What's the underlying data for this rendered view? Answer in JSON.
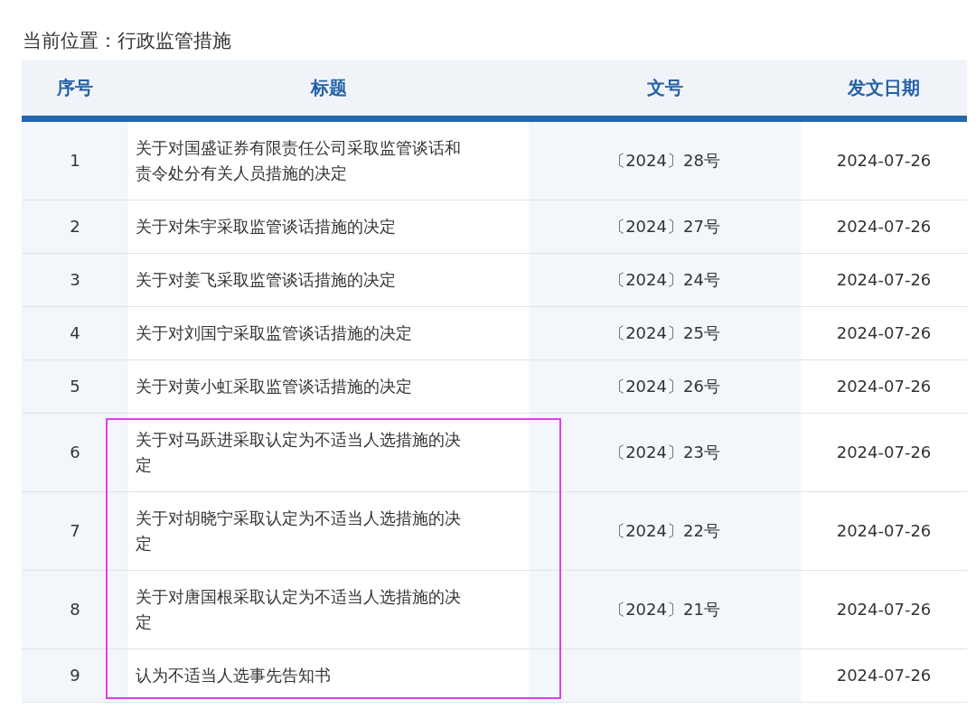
{
  "breadcrumb": {
    "label": "当前位置：",
    "current": "行政监管措施"
  },
  "table": {
    "columns": [
      "序号",
      "标题",
      "文号",
      "发文日期"
    ],
    "rows": [
      {
        "no": "1",
        "title": "关于对国盛证券有限责任公司采取监管谈话和责令处分有关人员措施的决定",
        "doc_no": "〔2024〕28号",
        "date": "2024-07-26",
        "highlighted": false
      },
      {
        "no": "2",
        "title": "关于对朱宇采取监管谈话措施的决定",
        "doc_no": "〔2024〕27号",
        "date": "2024-07-26",
        "highlighted": false
      },
      {
        "no": "3",
        "title": "关于对姜飞采取监管谈话措施的决定",
        "doc_no": "〔2024〕24号",
        "date": "2024-07-26",
        "highlighted": false
      },
      {
        "no": "4",
        "title": "关于对刘国宁采取监管谈话措施的决定",
        "doc_no": "〔2024〕25号",
        "date": "2024-07-26",
        "highlighted": false
      },
      {
        "no": "5",
        "title": "关于对黄小虹采取监管谈话措施的决定",
        "doc_no": "〔2024〕26号",
        "date": "2024-07-26",
        "highlighted": false
      },
      {
        "no": "6",
        "title": "关于对马跃进采取认定为不适当人选措施的决定",
        "doc_no": "〔2024〕23号",
        "date": "2024-07-26",
        "highlighted": true
      },
      {
        "no": "7",
        "title": "关于对胡晓宁采取认定为不适当人选措施的决定",
        "doc_no": "〔2024〕22号",
        "date": "2024-07-26",
        "highlighted": true
      },
      {
        "no": "8",
        "title": "关于对唐国根采取认定为不适当人选措施的决定",
        "doc_no": "〔2024〕21号",
        "date": "2024-07-26",
        "highlighted": true
      },
      {
        "no": "9",
        "title": "认为不适当人选事先告知书",
        "date": "2024-07-26",
        "highlighted": true
      }
    ]
  }
}
